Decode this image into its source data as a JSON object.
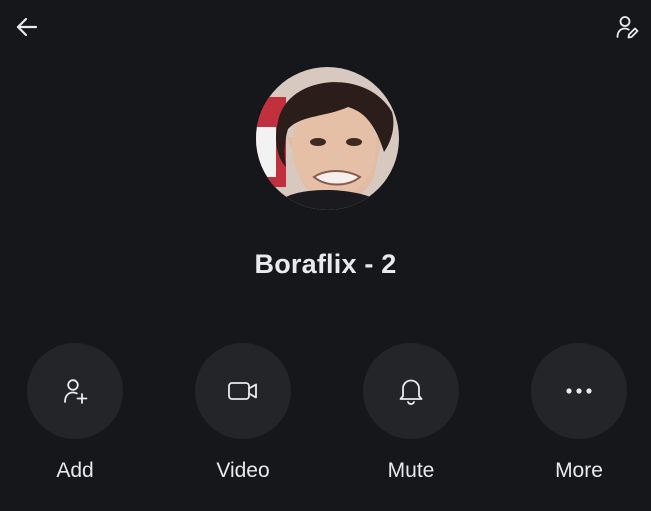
{
  "header": {
    "back_icon": "arrow-left-icon",
    "edit_icon": "person-edit-icon"
  },
  "group": {
    "avatar_alt": "group-avatar-photo",
    "name": "Boraflix - 2"
  },
  "actions": [
    {
      "label": "Add",
      "icon": "person-add-icon"
    },
    {
      "label": "Video",
      "icon": "video-camera-icon"
    },
    {
      "label": "Mute",
      "icon": "bell-icon"
    },
    {
      "label": "More",
      "icon": "more-dots-icon"
    }
  ],
  "colors": {
    "background": "#16171b",
    "button_background": "#232529",
    "text": "#e9eaed"
  }
}
